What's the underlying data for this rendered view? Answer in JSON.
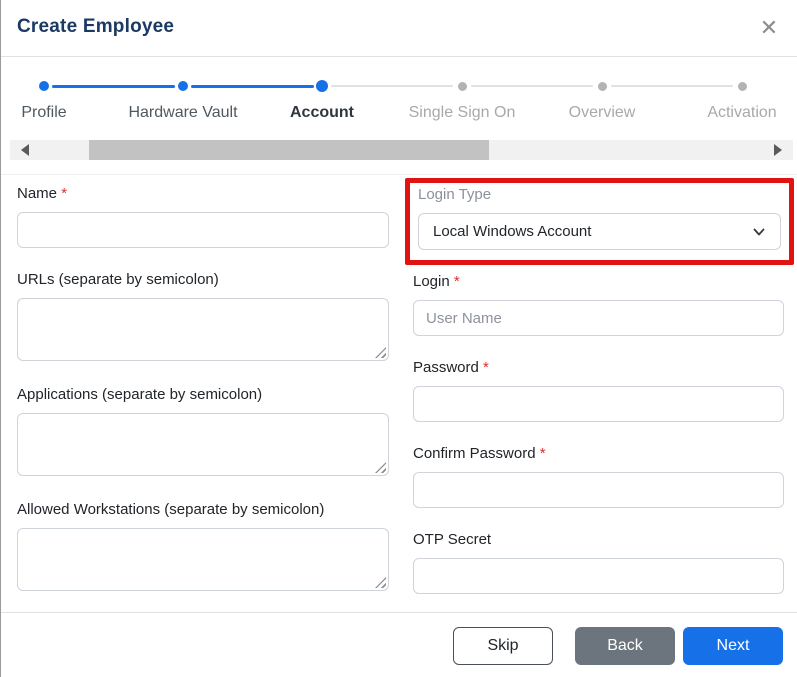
{
  "header": {
    "title": "Create Employee",
    "close_icon": "✕"
  },
  "stepper": [
    {
      "label": "Profile",
      "state": "done"
    },
    {
      "label": "Hardware Vault",
      "state": "done"
    },
    {
      "label": "Account",
      "state": "active"
    },
    {
      "label": "Single Sign On",
      "state": "todo"
    },
    {
      "label": "Overview",
      "state": "todo"
    },
    {
      "label": "Activation",
      "state": "todo"
    }
  ],
  "form": {
    "required_mark": "*",
    "name": {
      "label": "Name",
      "required": true,
      "value": ""
    },
    "urls": {
      "label": "URLs (separate by semicolon)",
      "value": ""
    },
    "applications": {
      "label": "Applications (separate by semicolon)",
      "value": ""
    },
    "workstations": {
      "label": "Allowed Workstations (separate by semicolon)",
      "value": ""
    },
    "login_type": {
      "label": "Login Type",
      "value": "Local Windows Account"
    },
    "login": {
      "label": "Login",
      "required": true,
      "placeholder": "User Name",
      "value": ""
    },
    "password": {
      "label": "Password",
      "required": true,
      "value": ""
    },
    "confirm_password": {
      "label": "Confirm Password",
      "required": true,
      "value": ""
    },
    "otp_secret": {
      "label": "OTP Secret",
      "value": ""
    }
  },
  "footer": {
    "skip_label": "Skip",
    "back_label": "Back",
    "next_label": "Next"
  },
  "colors": {
    "accent_blue": "#1671e8",
    "title_navy": "#1b3a63",
    "required_red": "#e12d2d",
    "highlight_red": "#e01212",
    "back_gray": "#6c757d",
    "inactive_gray": "#a9a9a9"
  }
}
